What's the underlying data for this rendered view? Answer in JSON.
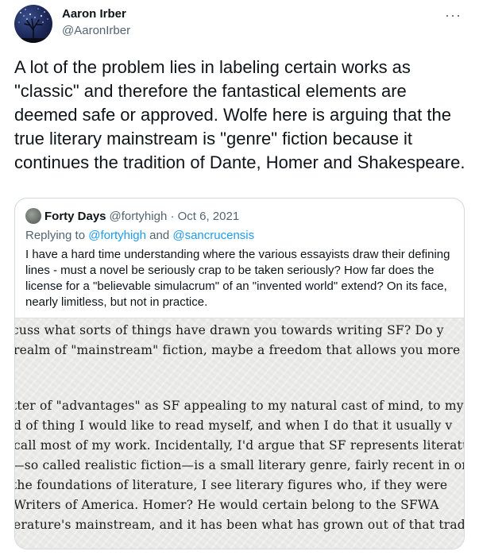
{
  "author": {
    "name": "Aaron Irber",
    "handle": "@AaronIrber"
  },
  "more_label": "···",
  "tweet_text": "A lot of the problem lies in labeling certain works as \"classic\" and therefore the fantastical elements are deemed safe or approved. Wolfe here is arguing that the true literary mainstream is \"genre\" fiction because it continues the tradition of Dante, Homer and Shakespeare.",
  "quote": {
    "name": "Forty Days",
    "meta": "@fortyhigh · Oct 6, 2021",
    "replying_prefix": "Replying to ",
    "reply_user_1": "@fortyhigh",
    "replying_and": " and ",
    "reply_user_2": "@sancrucensis",
    "body": "I have a hard time understanding where the various essayists draw their defining lines - must a novel be seriously crap to be taken seriously? How far does the license for a \"believable simulacrum\" of an \"invented world\" extend? On its face, nearly limitless, but not in practice.",
    "scan_lines": [
      "cuss what sorts of things have drawn you towards writing SF? Do y",
      " realm of \"mainstream\" fiction, maybe a freedom that allows you more",
      "tter of \"advantages\" as SF appealing to my natural cast of mind, to my lit",
      "d of thing I would like to read myself, and when I do that it usually v",
      " call most of my work. Incidentally, I'd argue that SF represents literatur",
      "—so called realistic fiction—is a small literary genre, fairly recent in orig",
      " the foundations of literature, I see literary figures who, if they were",
      " Writers of America. Homer? He would certain belong to the SFWA",
      "erature's mainstream, and it has been what has grown out of that tradit"
    ]
  }
}
